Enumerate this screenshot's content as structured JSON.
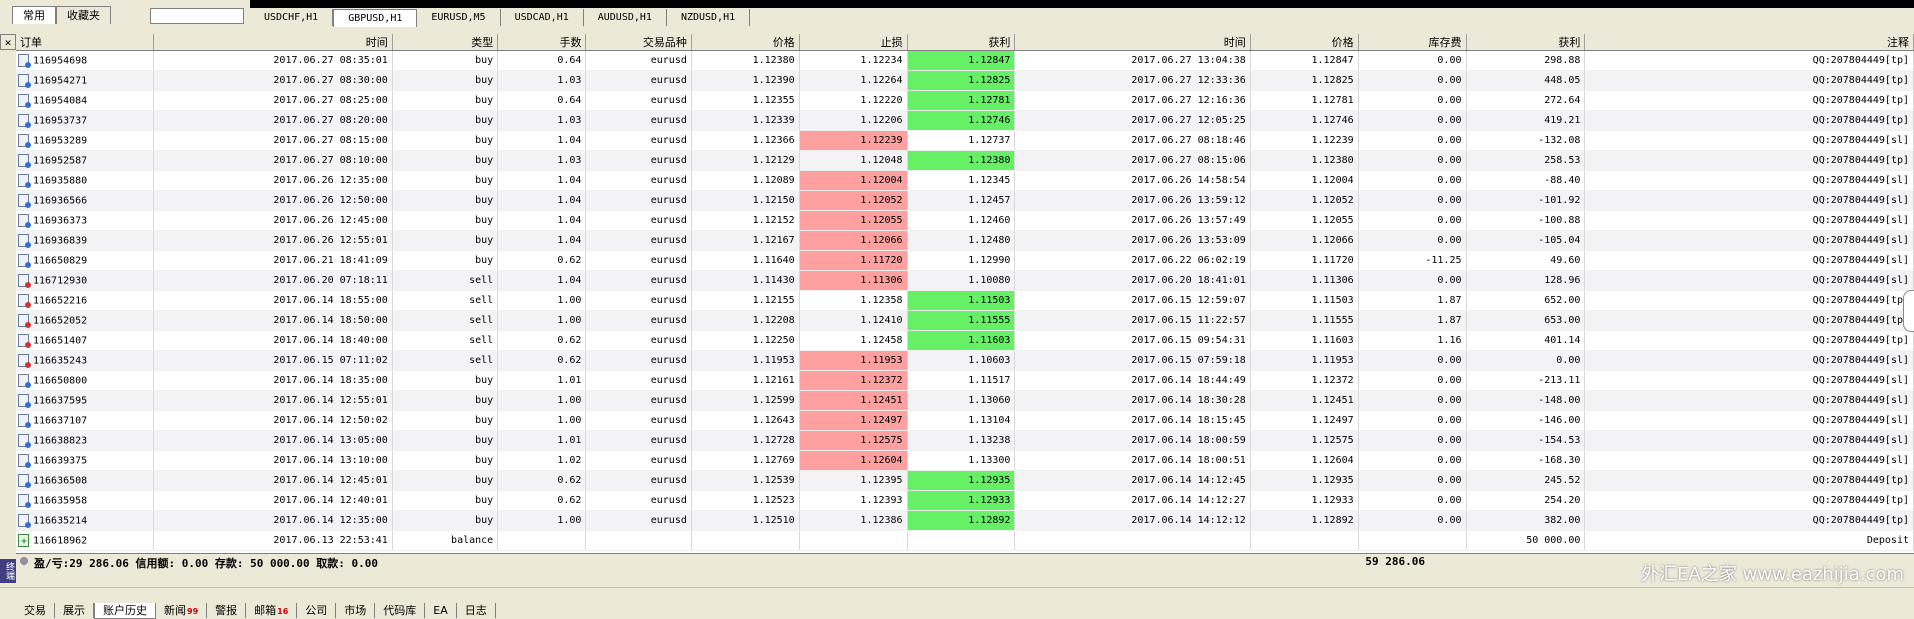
{
  "nav": {
    "tabs": [
      "常用",
      "收藏夹"
    ],
    "active": 0
  },
  "chart_tabs": {
    "items": [
      "USDCHF,H1",
      "GBPUSD,H1",
      "EURUSD,M5",
      "USDCAD,H1",
      "AUDUSD,H1",
      "NZDUSD,H1"
    ],
    "active": 1
  },
  "table": {
    "headers": [
      "订单",
      "时间",
      "类型",
      "手数",
      "交易品种",
      "价格",
      "止损",
      "获利",
      "时间",
      "价格",
      "库存费",
      "获利",
      "注释"
    ],
    "sort_indicator": "▽",
    "rows": [
      {
        "order": "116954698",
        "open_time": "2017.06.27 08:35:01",
        "type": "buy",
        "lots": "0.64",
        "symbol": "eurusd",
        "price": "1.12380",
        "sl": "1.12234",
        "tp": "1.12847",
        "close_time": "2017.06.27 13:04:38",
        "close_price": "1.12847",
        "swap": "0.00",
        "profit": "298.88",
        "comment": "QQ:207804449[tp]",
        "hl": "tp"
      },
      {
        "order": "116954271",
        "open_time": "2017.06.27 08:30:00",
        "type": "buy",
        "lots": "1.03",
        "symbol": "eurusd",
        "price": "1.12390",
        "sl": "1.12264",
        "tp": "1.12825",
        "close_time": "2017.06.27 12:33:36",
        "close_price": "1.12825",
        "swap": "0.00",
        "profit": "448.05",
        "comment": "QQ:207804449[tp]",
        "hl": "tp"
      },
      {
        "order": "116954084",
        "open_time": "2017.06.27 08:25:00",
        "type": "buy",
        "lots": "0.64",
        "symbol": "eurusd",
        "price": "1.12355",
        "sl": "1.12220",
        "tp": "1.12781",
        "close_time": "2017.06.27 12:16:36",
        "close_price": "1.12781",
        "swap": "0.00",
        "profit": "272.64",
        "comment": "QQ:207804449[tp]",
        "hl": "tp"
      },
      {
        "order": "116953737",
        "open_time": "2017.06.27 08:20:00",
        "type": "buy",
        "lots": "1.03",
        "symbol": "eurusd",
        "price": "1.12339",
        "sl": "1.12206",
        "tp": "1.12746",
        "close_time": "2017.06.27 12:05:25",
        "close_price": "1.12746",
        "swap": "0.00",
        "profit": "419.21",
        "comment": "QQ:207804449[tp]",
        "hl": "tp"
      },
      {
        "order": "116953289",
        "open_time": "2017.06.27 08:15:00",
        "type": "buy",
        "lots": "1.04",
        "symbol": "eurusd",
        "price": "1.12366",
        "sl": "1.12239",
        "tp": "1.12737",
        "close_time": "2017.06.27 08:18:46",
        "close_price": "1.12239",
        "swap": "0.00",
        "profit": "-132.08",
        "comment": "QQ:207804449[sl]",
        "hl": "sl"
      },
      {
        "order": "116952587",
        "open_time": "2017.06.27 08:10:00",
        "type": "buy",
        "lots": "1.03",
        "symbol": "eurusd",
        "price": "1.12129",
        "sl": "1.12048",
        "tp": "1.12380",
        "close_time": "2017.06.27 08:15:06",
        "close_price": "1.12380",
        "swap": "0.00",
        "profit": "258.53",
        "comment": "QQ:207804449[tp]",
        "hl": "tp"
      },
      {
        "order": "116935880",
        "open_time": "2017.06.26 12:35:00",
        "type": "buy",
        "lots": "1.04",
        "symbol": "eurusd",
        "price": "1.12089",
        "sl": "1.12004",
        "tp": "1.12345",
        "close_time": "2017.06.26 14:58:54",
        "close_price": "1.12004",
        "swap": "0.00",
        "profit": "-88.40",
        "comment": "QQ:207804449[sl]",
        "hl": "sl"
      },
      {
        "order": "116936566",
        "open_time": "2017.06.26 12:50:00",
        "type": "buy",
        "lots": "1.04",
        "symbol": "eurusd",
        "price": "1.12150",
        "sl": "1.12052",
        "tp": "1.12457",
        "close_time": "2017.06.26 13:59:12",
        "close_price": "1.12052",
        "swap": "0.00",
        "profit": "-101.92",
        "comment": "QQ:207804449[sl]",
        "hl": "sl"
      },
      {
        "order": "116936373",
        "open_time": "2017.06.26 12:45:00",
        "type": "buy",
        "lots": "1.04",
        "symbol": "eurusd",
        "price": "1.12152",
        "sl": "1.12055",
        "tp": "1.12460",
        "close_time": "2017.06.26 13:57:49",
        "close_price": "1.12055",
        "swap": "0.00",
        "profit": "-100.88",
        "comment": "QQ:207804449[sl]",
        "hl": "sl"
      },
      {
        "order": "116936839",
        "open_time": "2017.06.26 12:55:01",
        "type": "buy",
        "lots": "1.04",
        "symbol": "eurusd",
        "price": "1.12167",
        "sl": "1.12066",
        "tp": "1.12480",
        "close_time": "2017.06.26 13:53:09",
        "close_price": "1.12066",
        "swap": "0.00",
        "profit": "-105.04",
        "comment": "QQ:207804449[sl]",
        "hl": "sl"
      },
      {
        "order": "116650829",
        "open_time": "2017.06.21 18:41:09",
        "type": "buy",
        "lots": "0.62",
        "symbol": "eurusd",
        "price": "1.11640",
        "sl": "1.11720",
        "tp": "1.12990",
        "close_time": "2017.06.22 06:02:19",
        "close_price": "1.11720",
        "swap": "-11.25",
        "profit": "49.60",
        "comment": "QQ:207804449[sl]",
        "hl": "sl"
      },
      {
        "order": "116712930",
        "open_time": "2017.06.20 07:18:11",
        "type": "sell",
        "lots": "1.04",
        "symbol": "eurusd",
        "price": "1.11430",
        "sl": "1.11306",
        "tp": "1.10080",
        "close_time": "2017.06.20 18:41:01",
        "close_price": "1.11306",
        "swap": "0.00",
        "profit": "128.96",
        "comment": "QQ:207804449[sl]",
        "hl": "sl"
      },
      {
        "order": "116652216",
        "open_time": "2017.06.14 18:55:00",
        "type": "sell",
        "lots": "1.00",
        "symbol": "eurusd",
        "price": "1.12155",
        "sl": "1.12358",
        "tp": "1.11503",
        "close_time": "2017.06.15 12:59:07",
        "close_price": "1.11503",
        "swap": "1.87",
        "profit": "652.00",
        "comment": "QQ:207804449[tp]",
        "hl": "tp"
      },
      {
        "order": "116652052",
        "open_time": "2017.06.14 18:50:00",
        "type": "sell",
        "lots": "1.00",
        "symbol": "eurusd",
        "price": "1.12208",
        "sl": "1.12410",
        "tp": "1.11555",
        "close_time": "2017.06.15 11:22:57",
        "close_price": "1.11555",
        "swap": "1.87",
        "profit": "653.00",
        "comment": "QQ:207804449[tp]",
        "hl": "tp"
      },
      {
        "order": "116651407",
        "open_time": "2017.06.14 18:40:00",
        "type": "sell",
        "lots": "0.62",
        "symbol": "eurusd",
        "price": "1.12250",
        "sl": "1.12458",
        "tp": "1.11603",
        "close_time": "2017.06.15 09:54:31",
        "close_price": "1.11603",
        "swap": "1.16",
        "profit": "401.14",
        "comment": "QQ:207804449[tp]",
        "hl": "tp"
      },
      {
        "order": "116635243",
        "open_time": "2017.06.15 07:11:02",
        "type": "sell",
        "lots": "0.62",
        "symbol": "eurusd",
        "price": "1.11953",
        "sl": "1.11953",
        "tp": "1.10603",
        "close_time": "2017.06.15 07:59:18",
        "close_price": "1.11953",
        "swap": "0.00",
        "profit": "0.00",
        "comment": "QQ:207804449[sl]",
        "hl": "sl"
      },
      {
        "order": "116650800",
        "open_time": "2017.06.14 18:35:00",
        "type": "buy",
        "lots": "1.01",
        "symbol": "eurusd",
        "price": "1.12161",
        "sl": "1.12372",
        "tp": "1.11517",
        "close_time": "2017.06.14 18:44:49",
        "close_price": "1.12372",
        "swap": "0.00",
        "profit": "-213.11",
        "comment": "QQ:207804449[sl]",
        "hl": "sl"
      },
      {
        "order": "116637595",
        "open_time": "2017.06.14 12:55:01",
        "type": "buy",
        "lots": "1.00",
        "symbol": "eurusd",
        "price": "1.12599",
        "sl": "1.12451",
        "tp": "1.13060",
        "close_time": "2017.06.14 18:30:28",
        "close_price": "1.12451",
        "swap": "0.00",
        "profit": "-148.00",
        "comment": "QQ:207804449[sl]",
        "hl": "sl"
      },
      {
        "order": "116637107",
        "open_time": "2017.06.14 12:50:02",
        "type": "buy",
        "lots": "1.00",
        "symbol": "eurusd",
        "price": "1.12643",
        "sl": "1.12497",
        "tp": "1.13104",
        "close_time": "2017.06.14 18:15:45",
        "close_price": "1.12497",
        "swap": "0.00",
        "profit": "-146.00",
        "comment": "QQ:207804449[sl]",
        "hl": "sl"
      },
      {
        "order": "116638823",
        "open_time": "2017.06.14 13:05:00",
        "type": "buy",
        "lots": "1.01",
        "symbol": "eurusd",
        "price": "1.12728",
        "sl": "1.12575",
        "tp": "1.13238",
        "close_time": "2017.06.14 18:00:59",
        "close_price": "1.12575",
        "swap": "0.00",
        "profit": "-154.53",
        "comment": "QQ:207804449[sl]",
        "hl": "sl"
      },
      {
        "order": "116639375",
        "open_time": "2017.06.14 13:10:00",
        "type": "buy",
        "lots": "1.02",
        "symbol": "eurusd",
        "price": "1.12769",
        "sl": "1.12604",
        "tp": "1.13300",
        "close_time": "2017.06.14 18:00:51",
        "close_price": "1.12604",
        "swap": "0.00",
        "profit": "-168.30",
        "comment": "QQ:207804449[sl]",
        "hl": "sl"
      },
      {
        "order": "116636508",
        "open_time": "2017.06.14 12:45:01",
        "type": "buy",
        "lots": "0.62",
        "symbol": "eurusd",
        "price": "1.12539",
        "sl": "1.12395",
        "tp": "1.12935",
        "close_time": "2017.06.14 14:12:45",
        "close_price": "1.12935",
        "swap": "0.00",
        "profit": "245.52",
        "comment": "QQ:207804449[tp]",
        "hl": "tp"
      },
      {
        "order": "116635958",
        "open_time": "2017.06.14 12:40:01",
        "type": "buy",
        "lots": "0.62",
        "symbol": "eurusd",
        "price": "1.12523",
        "sl": "1.12393",
        "tp": "1.12933",
        "close_time": "2017.06.14 14:12:27",
        "close_price": "1.12933",
        "swap": "0.00",
        "profit": "254.20",
        "comment": "QQ:207804449[tp]",
        "hl": "tp"
      },
      {
        "order": "116635214",
        "open_time": "2017.06.14 12:35:00",
        "type": "buy",
        "lots": "1.00",
        "symbol": "eurusd",
        "price": "1.12510",
        "sl": "1.12386",
        "tp": "1.12892",
        "close_time": "2017.06.14 14:12:12",
        "close_price": "1.12892",
        "swap": "0.00",
        "profit": "382.00",
        "comment": "QQ:207804449[tp]",
        "hl": "tp"
      },
      {
        "order": "116618962",
        "open_time": "2017.06.13 22:53:41",
        "type": "balance",
        "lots": "",
        "symbol": "",
        "price": "",
        "sl": "",
        "tp": "",
        "close_time": "",
        "close_price": "",
        "swap": "",
        "profit": "50 000.00",
        "comment": "Deposit",
        "hl": ""
      }
    ]
  },
  "summary": {
    "text": "盈/亏:29 286.06  信用额: 0.00  存款: 50 000.00  取款: 0.00",
    "total": "59 286.06"
  },
  "bottom_tabs": [
    {
      "label": "交易",
      "badge": ""
    },
    {
      "label": "展示",
      "badge": ""
    },
    {
      "label": "账户历史",
      "badge": ""
    },
    {
      "label": "新闻",
      "badge": "99"
    },
    {
      "label": "警报",
      "badge": ""
    },
    {
      "label": "邮箱",
      "badge": "16"
    },
    {
      "label": "公司",
      "badge": ""
    },
    {
      "label": "市场",
      "badge": ""
    },
    {
      "label": "代码库",
      "badge": ""
    },
    {
      "label": "EA",
      "badge": ""
    },
    {
      "label": "日志",
      "badge": ""
    }
  ],
  "bottom_tabs_active": 2,
  "terminal_label": "终端",
  "watermark": "外汇EA之家 www.eazhijia.com",
  "colors": {
    "sl_highlight": "#ffa0a0",
    "tp_highlight": "#66f066"
  }
}
